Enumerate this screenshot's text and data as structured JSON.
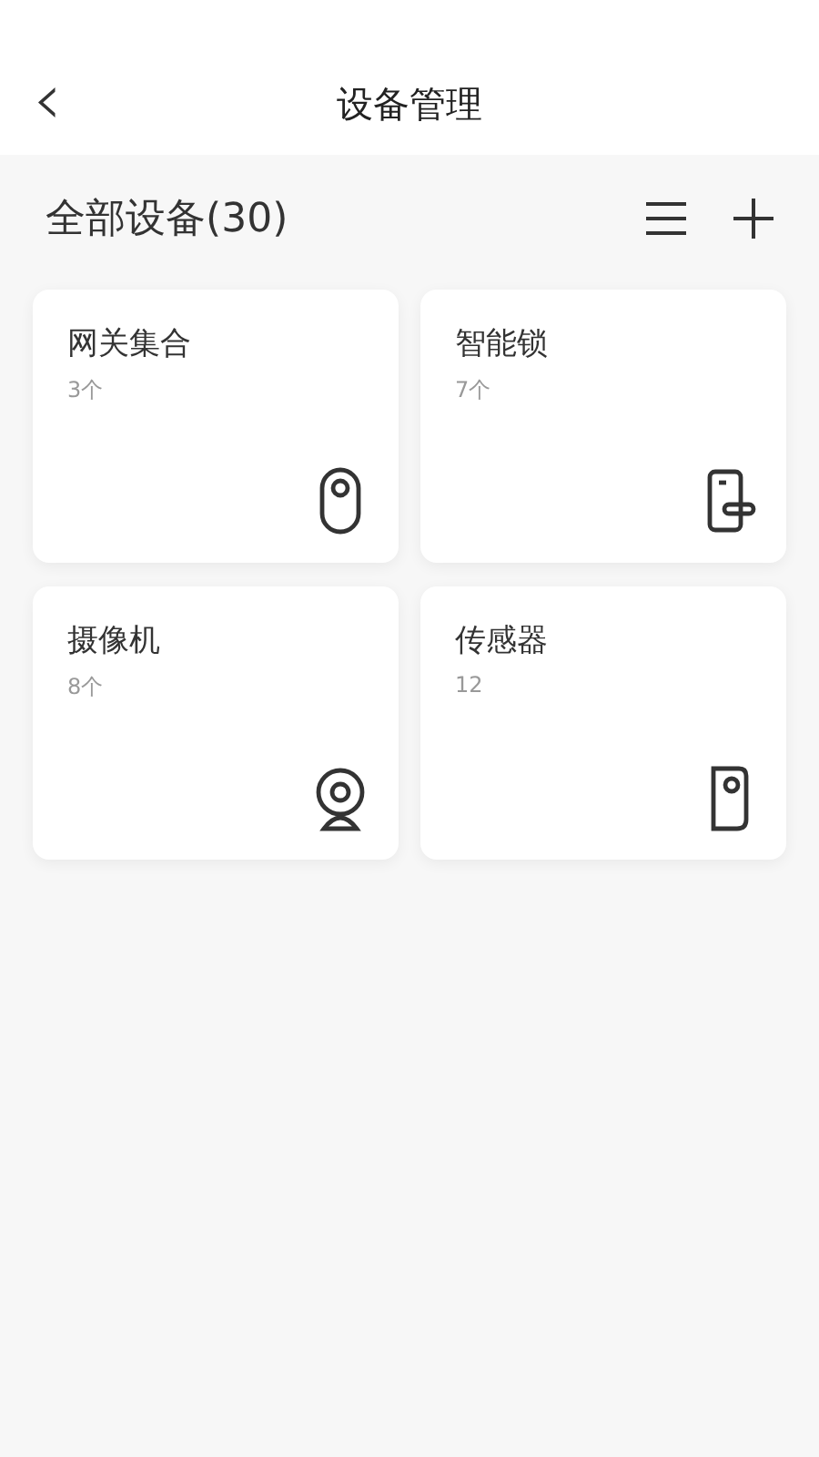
{
  "header": {
    "back": "‹",
    "title": "设备管理"
  },
  "section": {
    "title": "全部设备(30)"
  },
  "devices": [
    {
      "name": "网关集合",
      "count": "3个",
      "kind": "gateway"
    },
    {
      "name": "智能锁",
      "count": "7个",
      "kind": "lock"
    },
    {
      "name": "摄像机",
      "count": "8个",
      "kind": "camera"
    },
    {
      "name": "传感器",
      "count": "12",
      "kind": "sensor"
    }
  ]
}
